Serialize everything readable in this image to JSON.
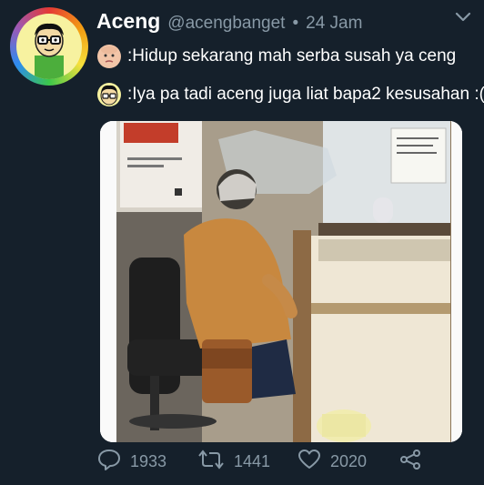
{
  "tweet": {
    "author_name": "Aceng",
    "author_handle": "@acengbanget",
    "separator": "•",
    "time": "24 Jam",
    "lines": [
      {
        "text": ":Hidup sekarang mah serba susah ya ceng",
        "emoji_icon": "baby-face-icon"
      },
      {
        "text": ":Iya pa tadi aceng juga liat bapa2 kesusahan :(",
        "emoji_icon": "cartoon-boy-face-icon"
      }
    ]
  },
  "actions": {
    "replies": "1933",
    "retweets": "1441",
    "likes": "2020"
  },
  "colors": {
    "background": "#15202b",
    "secondary_text": "#8899a6"
  }
}
